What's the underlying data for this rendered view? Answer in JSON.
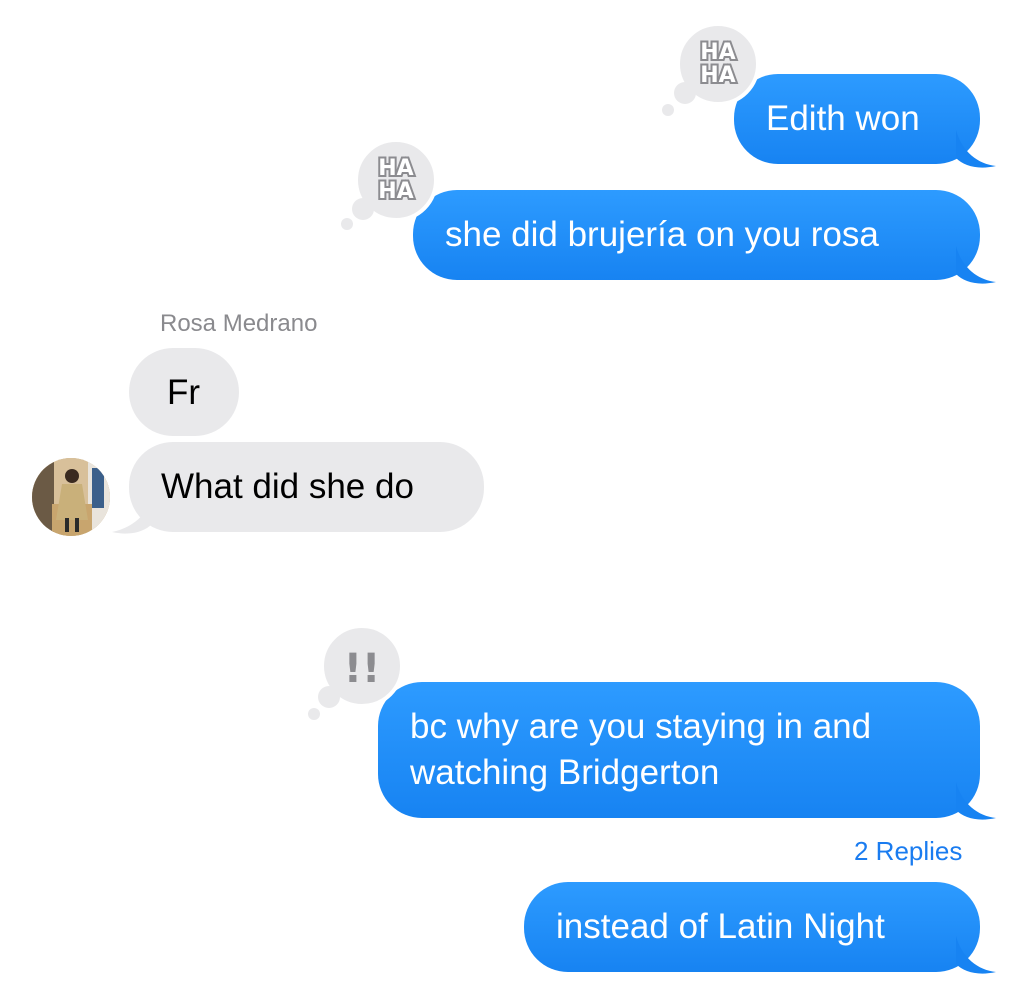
{
  "conversation": {
    "messages": [
      {
        "id": "m1",
        "direction": "outgoing",
        "text": "Edith won",
        "tapback": "haha"
      },
      {
        "id": "m2",
        "direction": "outgoing",
        "text": "she did brujería on you rosa",
        "tapback": "haha"
      },
      {
        "id": "m3",
        "direction": "incoming",
        "sender": "Rosa Medrano",
        "text": "Fr"
      },
      {
        "id": "m4",
        "direction": "incoming",
        "text": "What did she do"
      },
      {
        "id": "m5",
        "direction": "outgoing",
        "text_line1": "bc why are you staying in and",
        "text_line2": "watching Bridgerton",
        "tapback": "exclamation",
        "replies_label": "2 Replies"
      },
      {
        "id": "m6",
        "direction": "outgoing",
        "text": "instead of Latin Night"
      }
    ]
  },
  "tapbacks": {
    "haha_line1": "HA",
    "haha_line2": "HA",
    "exclamation": "!!"
  },
  "colors": {
    "outgoing_bubble": "#1f8bf5",
    "incoming_bubble": "#e9e9eb",
    "sender_name": "#8a8a8e",
    "replies_link": "#1a7cf0"
  },
  "icons": {
    "tapback_haha": "haha-icon",
    "tapback_emphasize": "double-exclamation-icon",
    "avatar": "contact-avatar"
  }
}
